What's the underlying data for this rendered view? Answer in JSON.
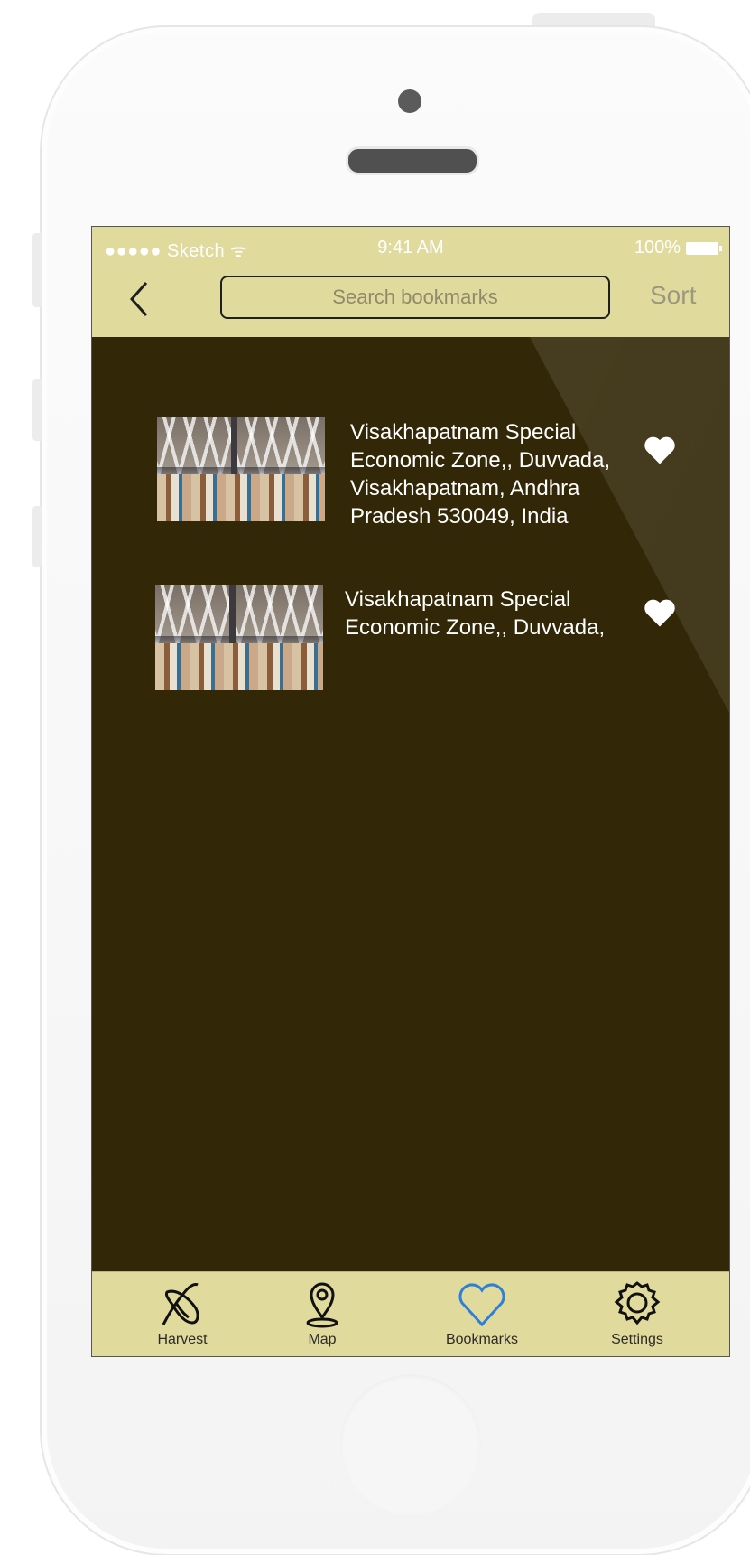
{
  "status_bar": {
    "carrier": "●●●●● Sketch ᯤ",
    "time": "9:41 AM",
    "battery": "100%"
  },
  "nav": {
    "search_placeholder": "Search bookmarks",
    "sort_label": "Sort"
  },
  "bookmarks": [
    {
      "address": "Visakhapatnam Special\nEconomic Zone,, Duvvada,\nVisakhapatnam, Andhra\nPradesh 530049, India",
      "favorited": true
    },
    {
      "address": "Visakhapatnam Special\nEconomic Zone,, Duvvada,",
      "favorited": true
    }
  ],
  "tabs": [
    {
      "label": "Harvest",
      "icon": "harvest-icon"
    },
    {
      "label": "Map",
      "icon": "map-pin-icon"
    },
    {
      "label": "Bookmarks",
      "icon": "heart-icon",
      "active": true
    },
    {
      "label": "Settings",
      "icon": "gear-icon"
    }
  ],
  "colors": {
    "accent": "#e1da9d",
    "background": "#322707",
    "active_tab": "#2f7fd6"
  }
}
